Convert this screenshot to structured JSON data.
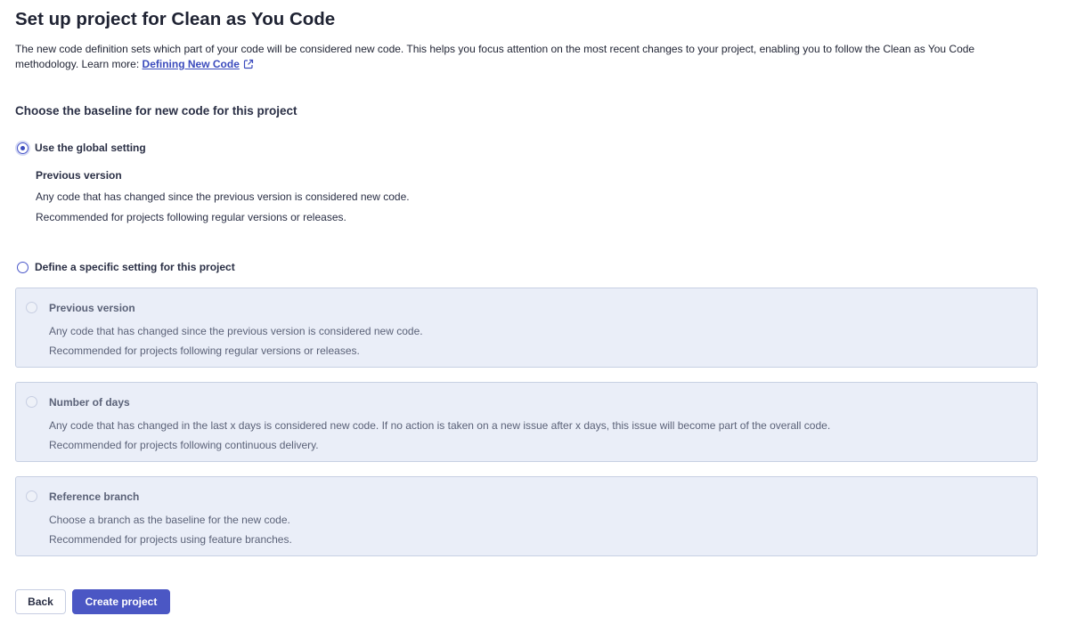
{
  "page": {
    "title": "Set up project for Clean as You Code",
    "intro_text": "The new code definition sets which part of your code will be considered new code. This helps you focus attention on the most recent changes to your project, enabling you to follow the Clean as You Code methodology. Learn more: ",
    "learn_more_link": "Defining New Code"
  },
  "baseline": {
    "heading": "Choose the baseline for new code for this project",
    "global_option": {
      "label": "Use the global setting",
      "selected": true,
      "setting_name": "Previous version",
      "description": "Any code that has changed since the previous version is considered new code.",
      "recommendation": "Recommended for projects following regular versions or releases."
    },
    "specific_option": {
      "label": "Define a specific setting for this project",
      "selected": false
    },
    "options": [
      {
        "name": "Previous version",
        "description": "Any code that has changed since the previous version is considered new code.",
        "recommendation": "Recommended for projects following regular versions or releases."
      },
      {
        "name": "Number of days",
        "description": "Any code that has changed in the last x days is considered new code. If no action is taken on a new issue after x days, this issue will become part of the overall code.",
        "recommendation": "Recommended for projects following continuous delivery."
      },
      {
        "name": "Reference branch",
        "description": "Choose a branch as the baseline for the new code.",
        "recommendation": "Recommended for projects using feature branches."
      }
    ]
  },
  "actions": {
    "back_label": "Back",
    "create_label": "Create project"
  },
  "colors": {
    "accent": "#4b57c4",
    "link": "#3b4bbd",
    "card_bg": "#eaeef8",
    "card_border": "#c7d0e3",
    "text": "#1f2333",
    "muted_text": "#5b6278"
  },
  "icons": {
    "external_link": "external-link-icon"
  }
}
